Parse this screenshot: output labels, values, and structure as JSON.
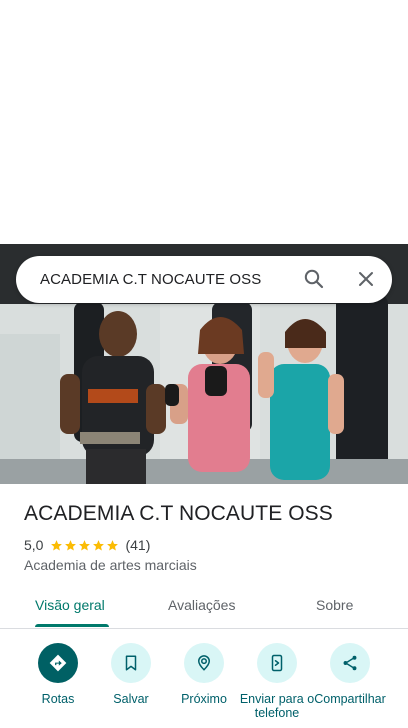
{
  "search": {
    "query": "ACADEMIA C.T NOCAUTE OSS"
  },
  "place": {
    "name": "ACADEMIA C.T NOCAUTE OSS",
    "rating": "5,0",
    "stars": 5,
    "review_count": "(41)",
    "category": "Academia de artes marciais"
  },
  "tabs": [
    {
      "label": "Visão geral",
      "active": true
    },
    {
      "label": "Avaliações",
      "active": false
    },
    {
      "label": "Sobre",
      "active": false
    }
  ],
  "actions": [
    {
      "label": "Rotas",
      "icon": "directions-icon"
    },
    {
      "label": "Salvar",
      "icon": "bookmark-icon"
    },
    {
      "label": "Próximo",
      "icon": "nearby-icon"
    },
    {
      "label": "Enviar para o telefone",
      "icon": "send-to-phone-icon"
    },
    {
      "label": "Compartilhar",
      "icon": "share-icon"
    }
  ],
  "colors": {
    "accent": "#00796b",
    "action_bg": "#d9f6f6",
    "action_primary": "#006064",
    "star": "#fbbc04"
  }
}
